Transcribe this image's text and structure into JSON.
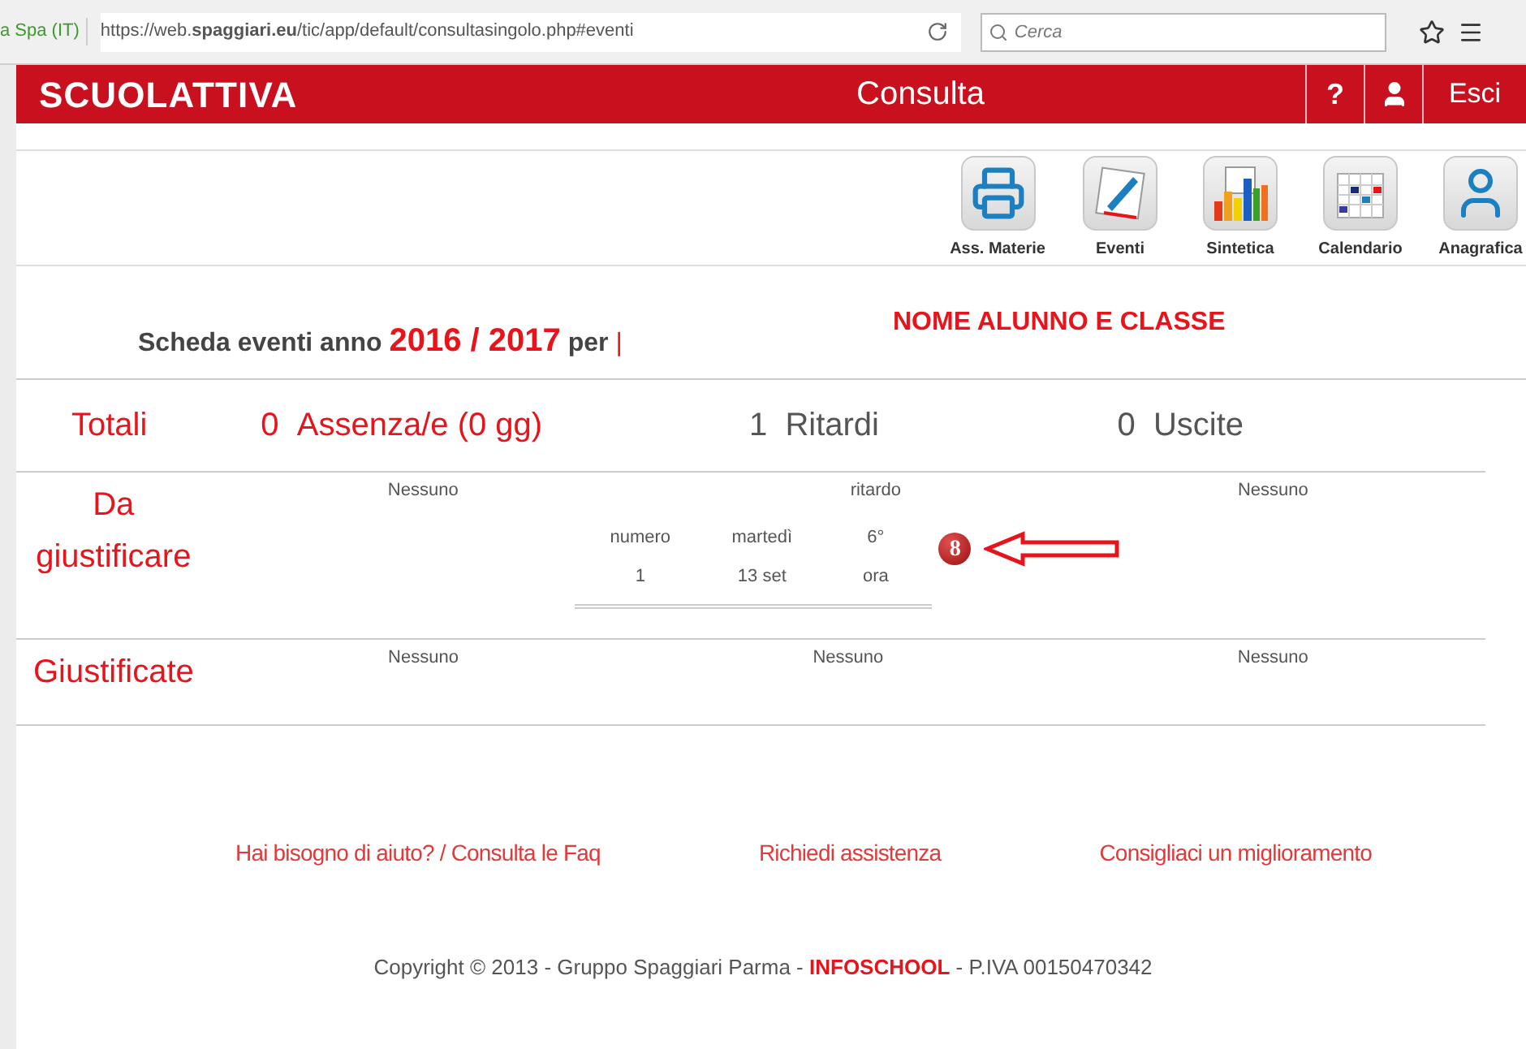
{
  "browser": {
    "site_label": "a Spa (IT)",
    "url": "https://web.**spaggiari.eu**/tic/app/default/consultasingolo.php#eventi",
    "search_placeholder": "Cerca"
  },
  "header": {
    "logo": "SCUOLATTIVA",
    "title": "Consulta",
    "help": "?",
    "logout": "Esci"
  },
  "toolbar": [
    {
      "kind": "printer",
      "label": "Ass. Materie"
    },
    {
      "kind": "note",
      "label": "Eventi"
    },
    {
      "kind": "chart",
      "label": "Sintetica"
    },
    {
      "kind": "calendar",
      "label": "Calendario"
    },
    {
      "kind": "person",
      "label": "Anagrafica"
    }
  ],
  "heading": {
    "prefix": "Scheda eventi anno",
    "year": "2016 / 2017",
    "suffix": "per",
    "cursor": "|",
    "student": "NOME ALUNNO E CLASSE"
  },
  "totals": {
    "label": "Totali",
    "items": [
      {
        "count": "0",
        "label": "Assenza/e (0 gg)",
        "color": "#e8141c"
      },
      {
        "count": "1",
        "label": "Ritardi",
        "color": "#555555"
      },
      {
        "count": "0",
        "label": "Uscite",
        "color": "#555555"
      }
    ]
  },
  "sections": [
    {
      "label": "Da giustificare",
      "columns": [
        {
          "kind": "empty",
          "text": "Nessuno"
        },
        {
          "kind": "events",
          "type_label": "ritardo",
          "headers": [
            "numero",
            "martedì",
            "6°"
          ],
          "values": [
            "1",
            "13 set",
            "ora"
          ],
          "badge": "8",
          "arrow": true
        },
        {
          "kind": "empty",
          "text": "Nessuno"
        }
      ]
    },
    {
      "label": "Giustificate",
      "columns": [
        {
          "kind": "empty",
          "text": "Nessuno"
        },
        {
          "kind": "empty",
          "text": "Nessuno"
        },
        {
          "kind": "empty",
          "text": "Nessuno"
        }
      ]
    }
  ],
  "footer": {
    "links": [
      "Hai bisogno di aiuto? / Consulta le Faq",
      "Richiedi assistenza",
      "Consigliaci un miglioramento"
    ],
    "copyright_prefix": "Copyright © 2013 - Gruppo Spaggiari Parma -",
    "brand": "INFOSCHOOL",
    "copyright_suffix": "- P.IVA 00150470342"
  }
}
